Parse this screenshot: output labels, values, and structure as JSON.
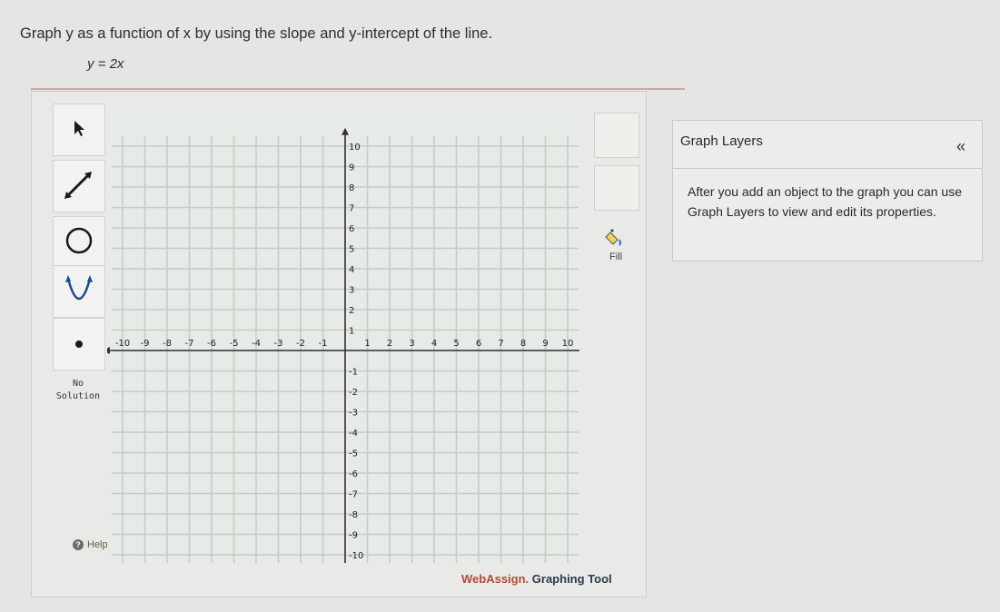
{
  "question": {
    "text": "Graph y as a function of x by using the slope and y-intercept of the line.",
    "equation": "y = 2x"
  },
  "tools": {
    "no_solution_line1": "No",
    "no_solution_line2": "Solution",
    "help_label": "Help",
    "fill_label": "Fill"
  },
  "graph": {
    "x_ticks": [
      "-10",
      "-9",
      "-8",
      "-7",
      "-6",
      "-5",
      "-4",
      "-3",
      "-2",
      "-1",
      "1",
      "2",
      "3",
      "4",
      "5",
      "6",
      "7",
      "8",
      "9",
      "10"
    ],
    "y_ticks": [
      "10",
      "9",
      "8",
      "7",
      "6",
      "5",
      "4",
      "3",
      "2",
      "1",
      "-1",
      "-2",
      "-3",
      "-4",
      "-5",
      "-6",
      "-7",
      "-8",
      "-9",
      "-10"
    ]
  },
  "layers": {
    "title": "Graph Layers",
    "collapse_symbol": "«",
    "body": "After you add an object to the graph you can use Graph Layers to view and edit its properties."
  },
  "footer": {
    "brand": "WebAssign.",
    "text": " Graphing Tool"
  },
  "colors": {
    "grid": "#c5cbc5",
    "axis": "#333333",
    "accent": "#b24a3a"
  }
}
